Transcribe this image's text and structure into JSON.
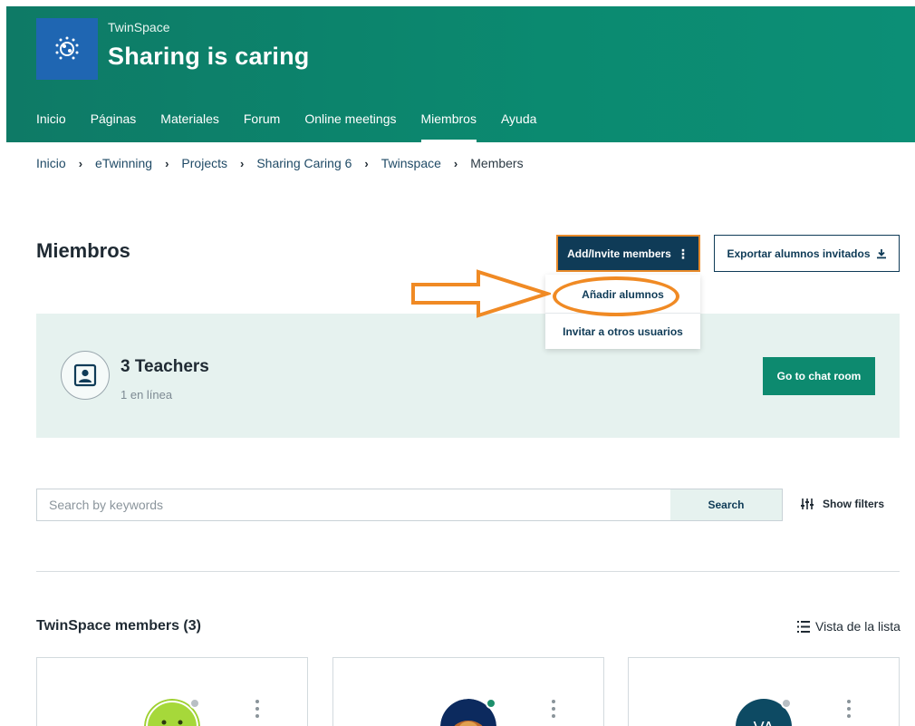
{
  "header": {
    "brand_small": "TwinSpace",
    "title": "Sharing is caring",
    "nav": [
      "Inicio",
      "Páginas",
      "Materiales",
      "Forum",
      "Online meetings",
      "Miembros",
      "Ayuda"
    ],
    "active_nav": "Miembros",
    "logo_icon": "twinning-stars-icon"
  },
  "breadcrumb": [
    "Inicio",
    "eTwinning",
    "Projects",
    "Sharing Caring 6",
    "Twinspace",
    "Members"
  ],
  "page": {
    "title": "Miembros",
    "add_button": "Add/Invite members",
    "export_button": "Exportar alumnos invitados"
  },
  "dropdown": {
    "items": [
      "Añadir alumnos",
      "Invitar a otros usuarios"
    ]
  },
  "teachers": {
    "count_label": "3 Teachers",
    "online_label": "1 en línea",
    "chat_button": "Go to chat room"
  },
  "search": {
    "placeholder": "Search by keywords",
    "value": "",
    "button": "Search",
    "filters_label": "Show filters"
  },
  "members": {
    "title": "TwinSpace members (3)",
    "view_toggle": "Vista de la lista",
    "cards": [
      {
        "status_color": "#b8bfc4",
        "avatar_bg": "#9ed030",
        "initials": ""
      },
      {
        "status_color": "#1d8f6c",
        "avatar_bg": "#0c2a5e",
        "initials": ""
      },
      {
        "status_color": "#b8bfc4",
        "avatar_bg": "#0d4a63",
        "initials": "VA"
      }
    ]
  },
  "colors": {
    "header": "#0b8a70",
    "primary_dark": "#0f3b57",
    "chat_green": "#0d8a6f",
    "annotation": "#f08a24",
    "panel": "#e6f2ef"
  }
}
